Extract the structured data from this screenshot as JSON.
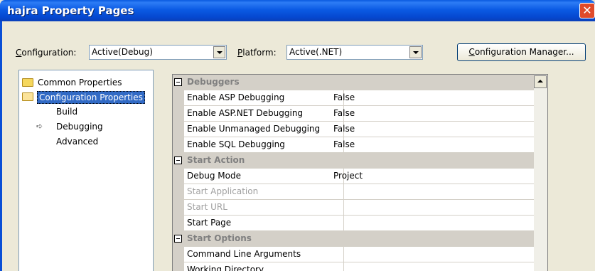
{
  "window": {
    "title": "hajra Property Pages",
    "close_glyph": "✕"
  },
  "config_bar": {
    "configuration_prefix": "C",
    "configuration_rest": "onfiguration:",
    "configuration_value": "Active(Debug)",
    "platform_prefix": "P",
    "platform_rest": "latform:",
    "platform_value": "Active(.NET)",
    "manager_prefix": "C",
    "manager_rest": "onfiguration Manager..."
  },
  "tree": {
    "items": [
      {
        "label": "Common Properties",
        "icon": "folder-closed-icon"
      },
      {
        "label": "Configuration Properties",
        "icon": "folder-open-icon",
        "selected": true
      },
      {
        "label": "Build"
      },
      {
        "label": "Debugging",
        "icon": "arrow-right-icon"
      },
      {
        "label": "Advanced"
      }
    ]
  },
  "grid": {
    "categories": [
      {
        "name": "Debuggers",
        "rows": [
          {
            "name": "Enable ASP Debugging",
            "value": "False"
          },
          {
            "name": "Enable ASP.NET Debugging",
            "value": "False"
          },
          {
            "name": "Enable Unmanaged Debugging",
            "value": "False"
          },
          {
            "name": "Enable SQL Debugging",
            "value": "False"
          }
        ]
      },
      {
        "name": "Start Action",
        "rows": [
          {
            "name": "Debug Mode",
            "value": "Project"
          },
          {
            "name": "Start Application",
            "value": "",
            "disabled": true
          },
          {
            "name": "Start URL",
            "value": "",
            "disabled": true
          },
          {
            "name": "Start Page",
            "value": ""
          }
        ]
      },
      {
        "name": "Start Options",
        "rows": [
          {
            "name": "Command Line Arguments",
            "value": ""
          },
          {
            "name": "Working Directory",
            "value": ""
          }
        ]
      }
    ]
  }
}
